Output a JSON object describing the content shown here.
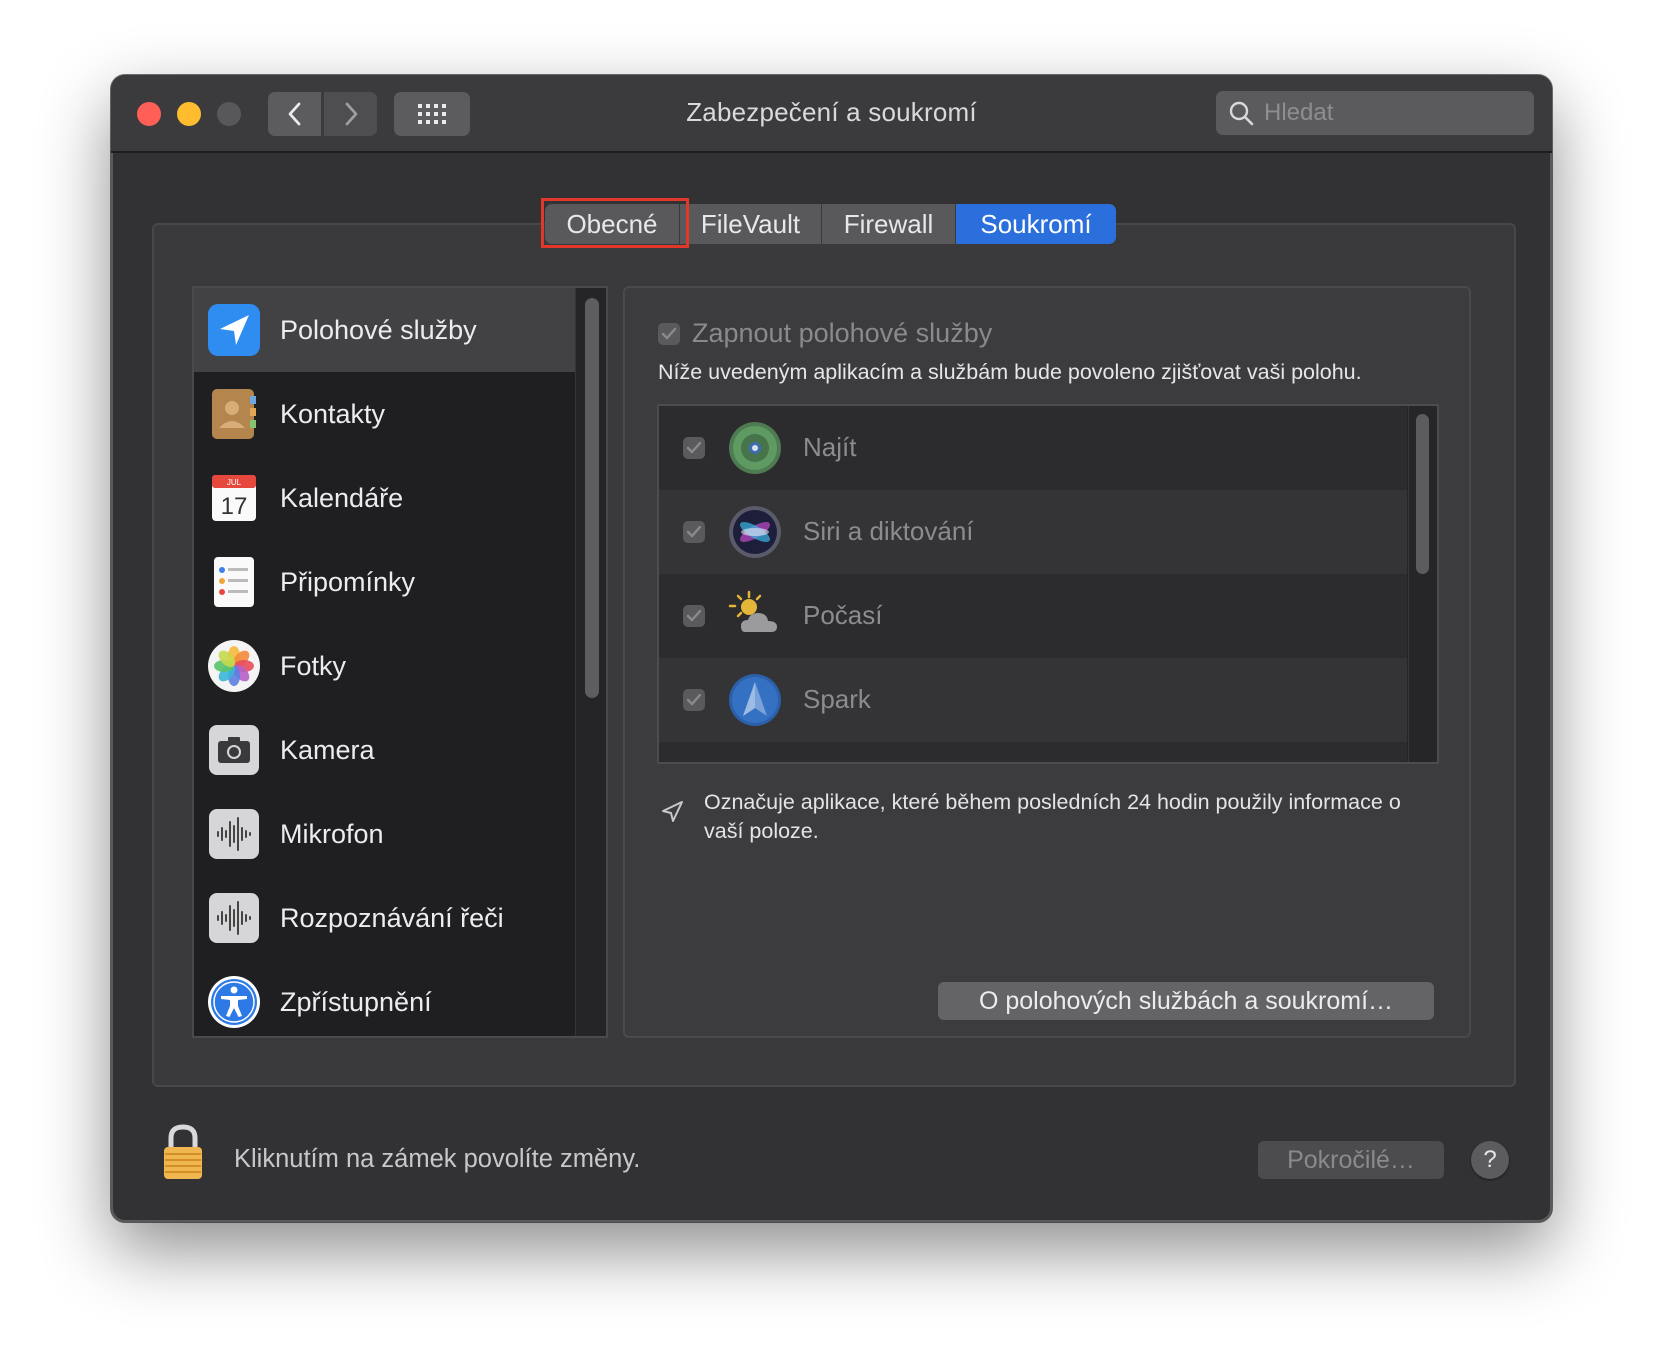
{
  "window": {
    "title": "Zabezpečení a soukromí"
  },
  "toolbar": {
    "back_icon": "chevron-left-icon",
    "forward_icon": "chevron-right-icon",
    "grid_icon": "grid-icon"
  },
  "search": {
    "placeholder": "Hledat"
  },
  "tabs": [
    {
      "label": "Obecné",
      "selected": false,
      "highlighted": true
    },
    {
      "label": "FileVault",
      "selected": false
    },
    {
      "label": "Firewall",
      "selected": false
    },
    {
      "label": "Soukromí",
      "selected": true
    }
  ],
  "sidebar": {
    "items": [
      {
        "label": "Polohové služby",
        "icon": "location-arrow-icon",
        "selected": true
      },
      {
        "label": "Kontakty",
        "icon": "contacts-icon"
      },
      {
        "label": "Kalendáře",
        "icon": "calendar-icon",
        "icon_text_month": "JUL",
        "icon_text_day": "17"
      },
      {
        "label": "Připomínky",
        "icon": "reminders-icon"
      },
      {
        "label": "Fotky",
        "icon": "photos-icon"
      },
      {
        "label": "Kamera",
        "icon": "camera-icon"
      },
      {
        "label": "Mikrofon",
        "icon": "microphone-icon"
      },
      {
        "label": "Rozpoznávání řeči",
        "icon": "speech-recognition-icon"
      },
      {
        "label": "Zpřístupnění",
        "icon": "accessibility-icon"
      }
    ]
  },
  "location": {
    "enable_label": "Zapnout polohové služby",
    "enable_checked": true,
    "subtitle": "Níže uvedeným aplikacím a službám bude povoleno zjišťovat vaši polohu.",
    "apps": [
      {
        "name": "Najít",
        "checked": true,
        "icon": "find-my-icon"
      },
      {
        "name": "Siri a diktování",
        "checked": true,
        "icon": "siri-icon"
      },
      {
        "name": "Počasí",
        "checked": true,
        "icon": "weather-icon"
      },
      {
        "name": "Spark",
        "checked": true,
        "icon": "spark-icon"
      }
    ],
    "note": "Označuje aplikace, které během posledních 24 hodin použily informace o vaší poloze.",
    "about_button": "O polohových službách a soukromí…"
  },
  "footer": {
    "lock_text": "Kliknutím na zámek povolíte změny.",
    "advanced_button": "Pokročilé…",
    "help_button": "?"
  },
  "colors": {
    "accent": "#2a6fdb",
    "highlight_border": "#e2372b",
    "window_bg": "#323234"
  }
}
